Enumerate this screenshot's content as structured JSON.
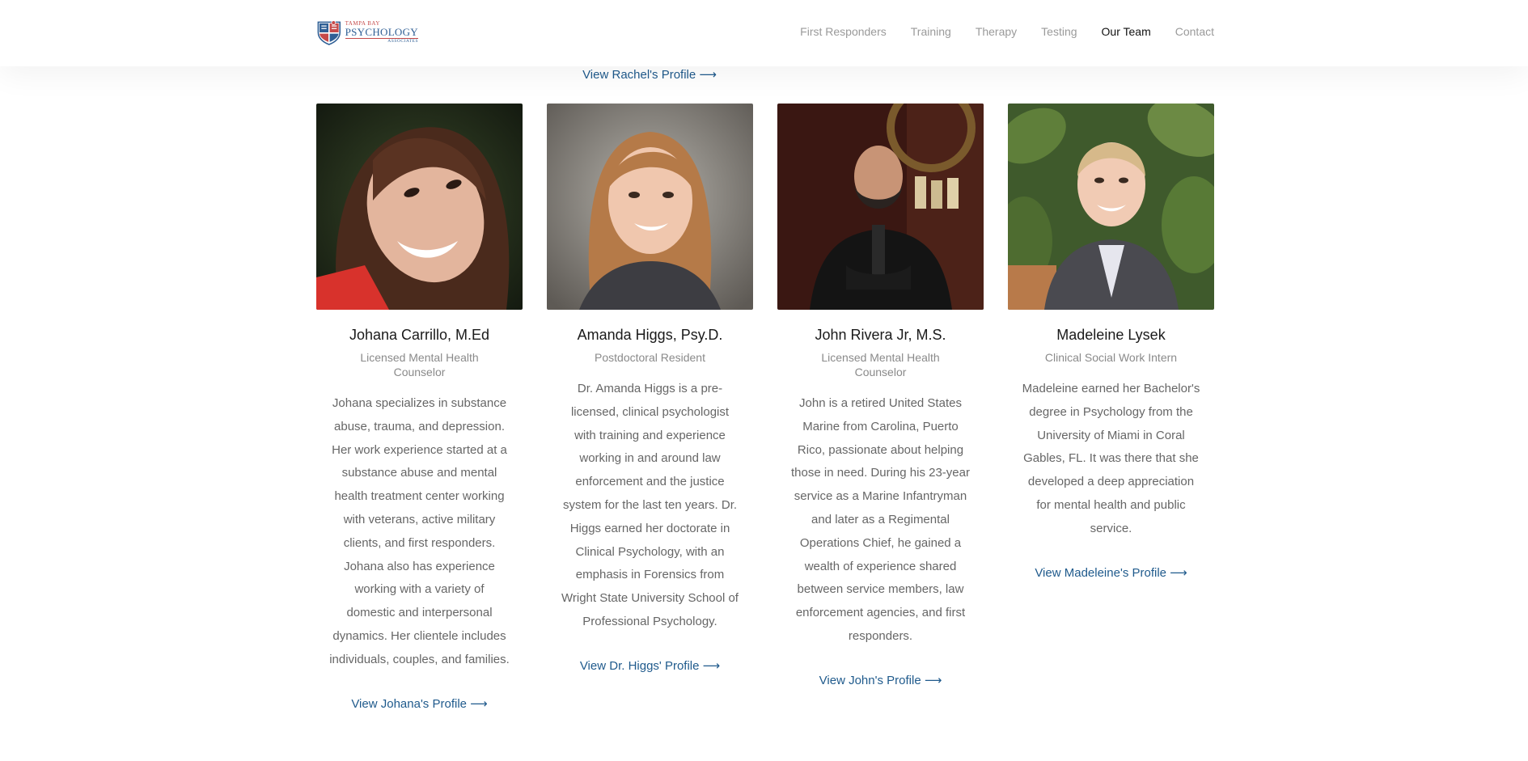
{
  "brand": {
    "top": "TAMPA BAY",
    "main": "PSYCHOLOGY",
    "sub": "ASSOCIATES",
    "colors": {
      "blue": "#2f5f95",
      "red": "#c54a4a"
    }
  },
  "nav": {
    "items": [
      {
        "label": "First Responders",
        "active": false
      },
      {
        "label": "Training",
        "active": false
      },
      {
        "label": "Therapy",
        "active": false
      },
      {
        "label": "Testing",
        "active": false
      },
      {
        "label": "Our Team",
        "active": true
      },
      {
        "label": "Contact",
        "active": false
      }
    ]
  },
  "top_link": "View Rachel's Profile ⟶",
  "team": [
    {
      "name": "Johana Carrillo, M.Ed",
      "role": "Licensed Mental Health Counselor",
      "bio": "Johana specializes in substance abuse, trauma, and depression. Her work experience started at a substance abuse and mental health treatment center working with veterans, active military clients, and first responders. Johana also has experience working with a variety of domestic and interpersonal dynamics. Her clientele includes individuals, couples, and families.",
      "link": "View Johana's Profile ⟶"
    },
    {
      "name": "Amanda Higgs, Psy.D.",
      "role": "Postdoctoral Resident",
      "bio": "Dr. Amanda Higgs is a pre-licensed, clinical psychologist with training and experience working in and around law enforcement and the justice system for the last ten years. Dr. Higgs earned her doctorate in Clinical Psychology, with an emphasis in Forensics from Wright State University School of Professional Psychology.",
      "link": "View Dr. Higgs' Profile ⟶"
    },
    {
      "name": "John Rivera Jr, M.S.",
      "role": "Licensed Mental Health Counselor",
      "bio": "John is a retired United States Marine from Carolina, Puerto Rico, passionate about helping those in need. During his 23-year service as a Marine Infantryman and later as a Regimental Operations Chief, he gained a wealth of experience shared between service members, law enforcement agencies, and first responders.",
      "link": "View John's Profile ⟶"
    },
    {
      "name": "Madeleine Lysek",
      "role": "Clinical Social Work Intern",
      "bio": "Madeleine earned her Bachelor's degree in Psychology from the University of Miami in Coral Gables, FL. It was there that she developed a deep appreciation for mental health and public service.",
      "link": "View Madeleine's Profile ⟶"
    }
  ]
}
